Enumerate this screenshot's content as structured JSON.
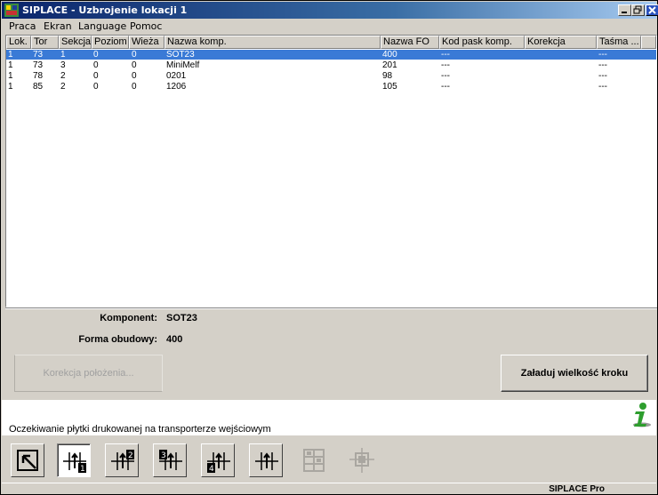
{
  "window": {
    "title": "SIPLACE - Uzbrojenie lokacji 1"
  },
  "menu": [
    "Praca",
    "Ekran",
    "Language",
    "Pomoc"
  ],
  "table": {
    "columns": [
      "Lok.",
      "Tor",
      "Sekcja",
      "Poziom",
      "Wieża",
      "Nazwa komp.",
      "Nazwa FO",
      "Kod pask komp.",
      "Korekcja",
      "Taśma ..."
    ],
    "rows": [
      [
        "1",
        "73",
        "1",
        "0",
        "0",
        "SOT23",
        "400",
        "---",
        "",
        "---"
      ],
      [
        "1",
        "73",
        "3",
        "0",
        "0",
        "MiniMelf",
        "201",
        "---",
        "",
        "---"
      ],
      [
        "1",
        "78",
        "2",
        "0",
        "0",
        "0201",
        "98",
        "---",
        "",
        "---"
      ],
      [
        "1",
        "85",
        "2",
        "0",
        "0",
        "1206",
        "105",
        "---",
        "",
        "---"
      ]
    ],
    "selected_row": 0
  },
  "details": {
    "component_label": "Komponent:",
    "component_value": "SOT23",
    "package_label": "Forma obudowy:",
    "package_value": "400"
  },
  "buttons": {
    "position_correction": "Korekcja położenia...",
    "load_step_size": "Załaduj wielkość kroku"
  },
  "status": {
    "message": "Oczekiwanie płytki drukowanej na transporterze wejściowym"
  },
  "toolbar": {
    "tools": [
      "arrow-return-icon",
      "conveyor-1-icon",
      "conveyor-2-icon",
      "conveyor-3-icon",
      "conveyor-4-icon",
      "conveyor-all-icon",
      "board-grid-icon",
      "board-target-icon"
    ],
    "active_index": 1
  },
  "footer": {
    "brand": "SIPLACE Pro"
  },
  "colors": {
    "selection": "#3a7ad6",
    "title_start": "#0a246a",
    "info_green": "#2e9e2e"
  }
}
